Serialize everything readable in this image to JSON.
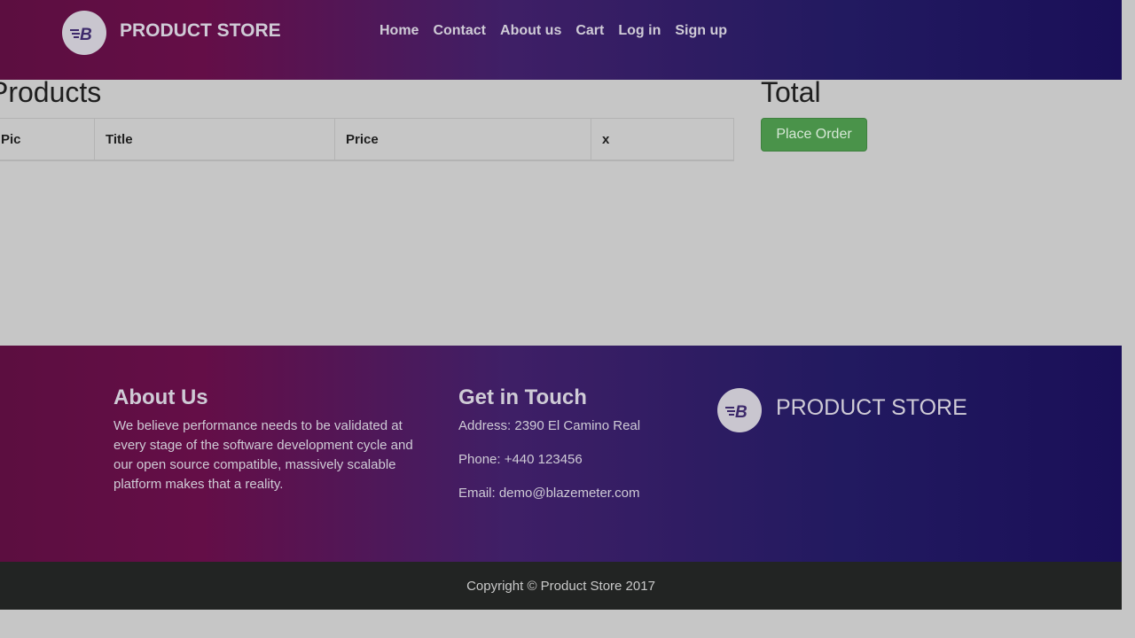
{
  "navbar": {
    "brand": "PRODUCT STORE",
    "logo_icon": "blazemeter-logo-icon",
    "links": [
      "Home",
      "Contact",
      "About us",
      "Cart",
      "Log in",
      "Sign up"
    ]
  },
  "main": {
    "products_heading": "Products",
    "table_headers": [
      "Pic",
      "Title",
      "Price",
      "x"
    ],
    "table_rows": [],
    "total_heading": "Total",
    "place_order_label": "Place Order"
  },
  "footer": {
    "about_title": "About Us",
    "about_text": "We believe performance needs to be validated at every stage of the software development cycle and our open source compatible, massively scalable platform makes that a reality.",
    "contact_title": "Get in Touch",
    "address": "Address: 2390 El Camino Real",
    "phone": "Phone: +440 123456",
    "email": "Email: demo@blazemeter.com",
    "brand": "PRODUCT STORE",
    "copyright": "Copyright © Product Store 2017"
  },
  "colors": {
    "gradient_start": "#640e47",
    "gradient_end": "#1a0f58",
    "order_button": "#4a934a",
    "page_background": "#c6c6c6"
  }
}
